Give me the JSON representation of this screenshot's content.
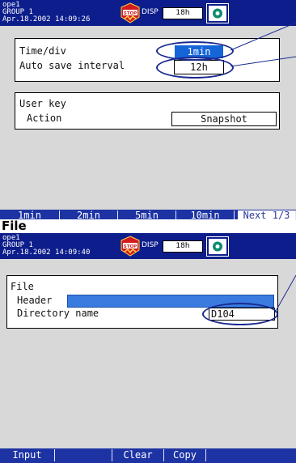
{
  "screen1": {
    "status": {
      "user": "ope1",
      "group": "GROUP 1",
      "datetime": "Apr.18.2002 14:09:26",
      "stop_badge": "STOP",
      "disp_label": "DISP",
      "span": "18h"
    },
    "settings_panel": {
      "rows": [
        {
          "label": "Time/div",
          "value": "1min"
        },
        {
          "label": "Auto save interval",
          "value": "12h"
        }
      ]
    },
    "user_key_panel": {
      "title": "User key",
      "action_label": "Action",
      "action_value": "Snapshot"
    },
    "softkeys": [
      "1min",
      "2min",
      "5min",
      "10min",
      "Next 1/3"
    ]
  },
  "caption": "File",
  "screen2": {
    "status": {
      "user": "ope1",
      "group": "GROUP 1",
      "datetime": "Apr.18.2002 14:09:40",
      "stop_badge": "STOP",
      "disp_label": "DISP",
      "span": "18h"
    },
    "file_panel": {
      "title": "File",
      "header_label": "Header",
      "header_value": "",
      "directory_label": "Directory name",
      "directory_value": "D104"
    },
    "softkeys": [
      "Input",
      "",
      "Clear",
      "Copy"
    ]
  },
  "colors": {
    "status_bar": "#0d1e8c",
    "softkey_bar": "#1d33a4",
    "selected_value": "#1565d8",
    "screen_bg": "#d8d8d8",
    "callout": "#1a2a8f"
  },
  "icons": [
    "stop-badge-icon",
    "disk-icon"
  ]
}
